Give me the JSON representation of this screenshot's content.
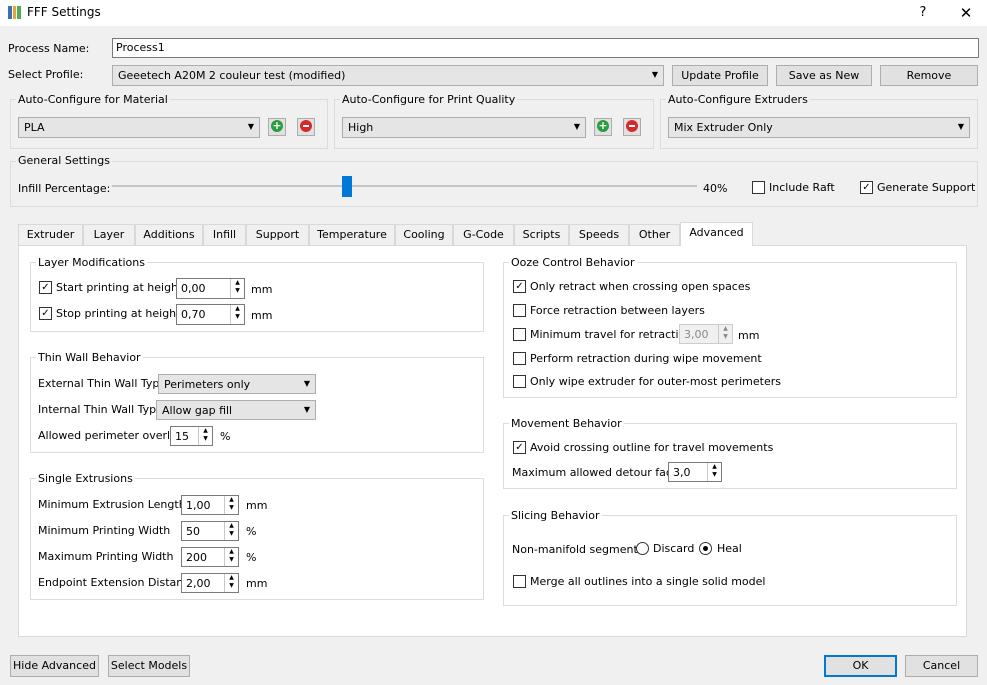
{
  "window": {
    "title": "FFF Settings",
    "help": "?",
    "close": "✕"
  },
  "process": {
    "label": "Process Name:",
    "value": "Process1"
  },
  "profile": {
    "label": "Select Profile:",
    "value": "Geeetech A20M 2 couleur test (modified)",
    "update": "Update Profile",
    "save_as": "Save as New",
    "remove": "Remove"
  },
  "material": {
    "title": "Auto-Configure for Material",
    "value": "PLA"
  },
  "quality": {
    "title": "Auto-Configure for Print Quality",
    "value": "High"
  },
  "extruders": {
    "title": "Auto-Configure Extruders",
    "value": "Mix Extruder Only"
  },
  "general": {
    "title": "General Settings",
    "infill_label": "Infill Percentage:",
    "infill_value": "40%",
    "infill_fraction": 0.4,
    "raft_label": "Include Raft",
    "raft_checked": false,
    "support_label": "Generate Support",
    "support_checked": true
  },
  "tabs": [
    "Extruder",
    "Layer",
    "Additions",
    "Infill",
    "Support",
    "Temperature",
    "Cooling",
    "G-Code",
    "Scripts",
    "Speeds",
    "Other",
    "Advanced"
  ],
  "active_tab": "Advanced",
  "layer_mod": {
    "title": "Layer Modifications",
    "start_label": "Start printing at height",
    "start_value": "0,00",
    "stop_label": "Stop printing at height",
    "stop_value": "0,70",
    "unit": "mm"
  },
  "thin_wall": {
    "title": "Thin Wall Behavior",
    "external_label": "External Thin Wall Type",
    "external_value": "Perimeters only",
    "internal_label": "Internal Thin Wall Type",
    "internal_value": "Allow gap fill",
    "overlap_label": "Allowed perimeter overlap",
    "overlap_value": "15",
    "overlap_unit": "%"
  },
  "single_ext": {
    "title": "Single Extrusions",
    "min_len_label": "Minimum Extrusion Length",
    "min_len_value": "1,00",
    "min_len_unit": "mm",
    "min_w_label": "Minimum Printing Width",
    "min_w_value": "50",
    "min_w_unit": "%",
    "max_w_label": "Maximum Printing Width",
    "max_w_value": "200",
    "max_w_unit": "%",
    "endpoint_label": "Endpoint Extension Distance",
    "endpoint_value": "2,00",
    "endpoint_unit": "mm"
  },
  "ooze": {
    "title": "Ooze Control Behavior",
    "only_retract": "Only retract when crossing open spaces",
    "force_retract": "Force retraction between layers",
    "min_travel": "Minimum travel for retraction",
    "min_travel_value": "3,00",
    "min_travel_unit": "mm",
    "wipe_retract": "Perform retraction during wipe movement",
    "only_wipe": "Only wipe extruder for outer-most perimeters"
  },
  "movement": {
    "title": "Movement Behavior",
    "avoid": "Avoid crossing outline for travel movements",
    "detour_label": "Maximum allowed detour factor",
    "detour_value": "3,0"
  },
  "slicing": {
    "title": "Slicing Behavior",
    "nonmanifold_label": "Non-manifold segments:",
    "discard": "Discard",
    "heal": "Heal",
    "merge": "Merge all outlines into a single solid model"
  },
  "footer": {
    "hide_advanced": "Hide Advanced",
    "select_models": "Select Models",
    "ok": "OK",
    "cancel": "Cancel"
  },
  "colors": {
    "accent": "#0078d7",
    "plus": "#2a9d3e",
    "minus": "#d42a2a"
  },
  "check": "✓",
  "arrow": "▼"
}
